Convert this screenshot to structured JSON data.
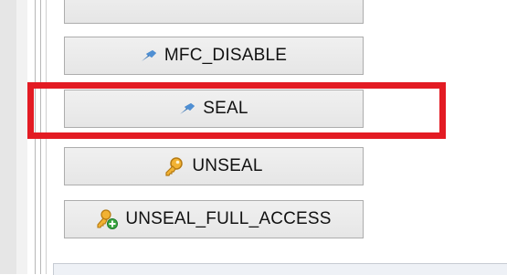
{
  "buttons": {
    "top_partial": {
      "label": ""
    },
    "mfc_disable": {
      "label": "MFC_DISABLE",
      "icon": "pin-icon"
    },
    "seal": {
      "label": "SEAL",
      "icon": "pin-icon"
    },
    "unseal": {
      "label": "UNSEAL",
      "icon": "key-icon"
    },
    "unseal_full_access": {
      "label": "UNSEAL_FULL_ACCESS",
      "icon": "user-add-icon"
    }
  },
  "highlight": {
    "color": "#e31b23",
    "target": "SEAL"
  }
}
